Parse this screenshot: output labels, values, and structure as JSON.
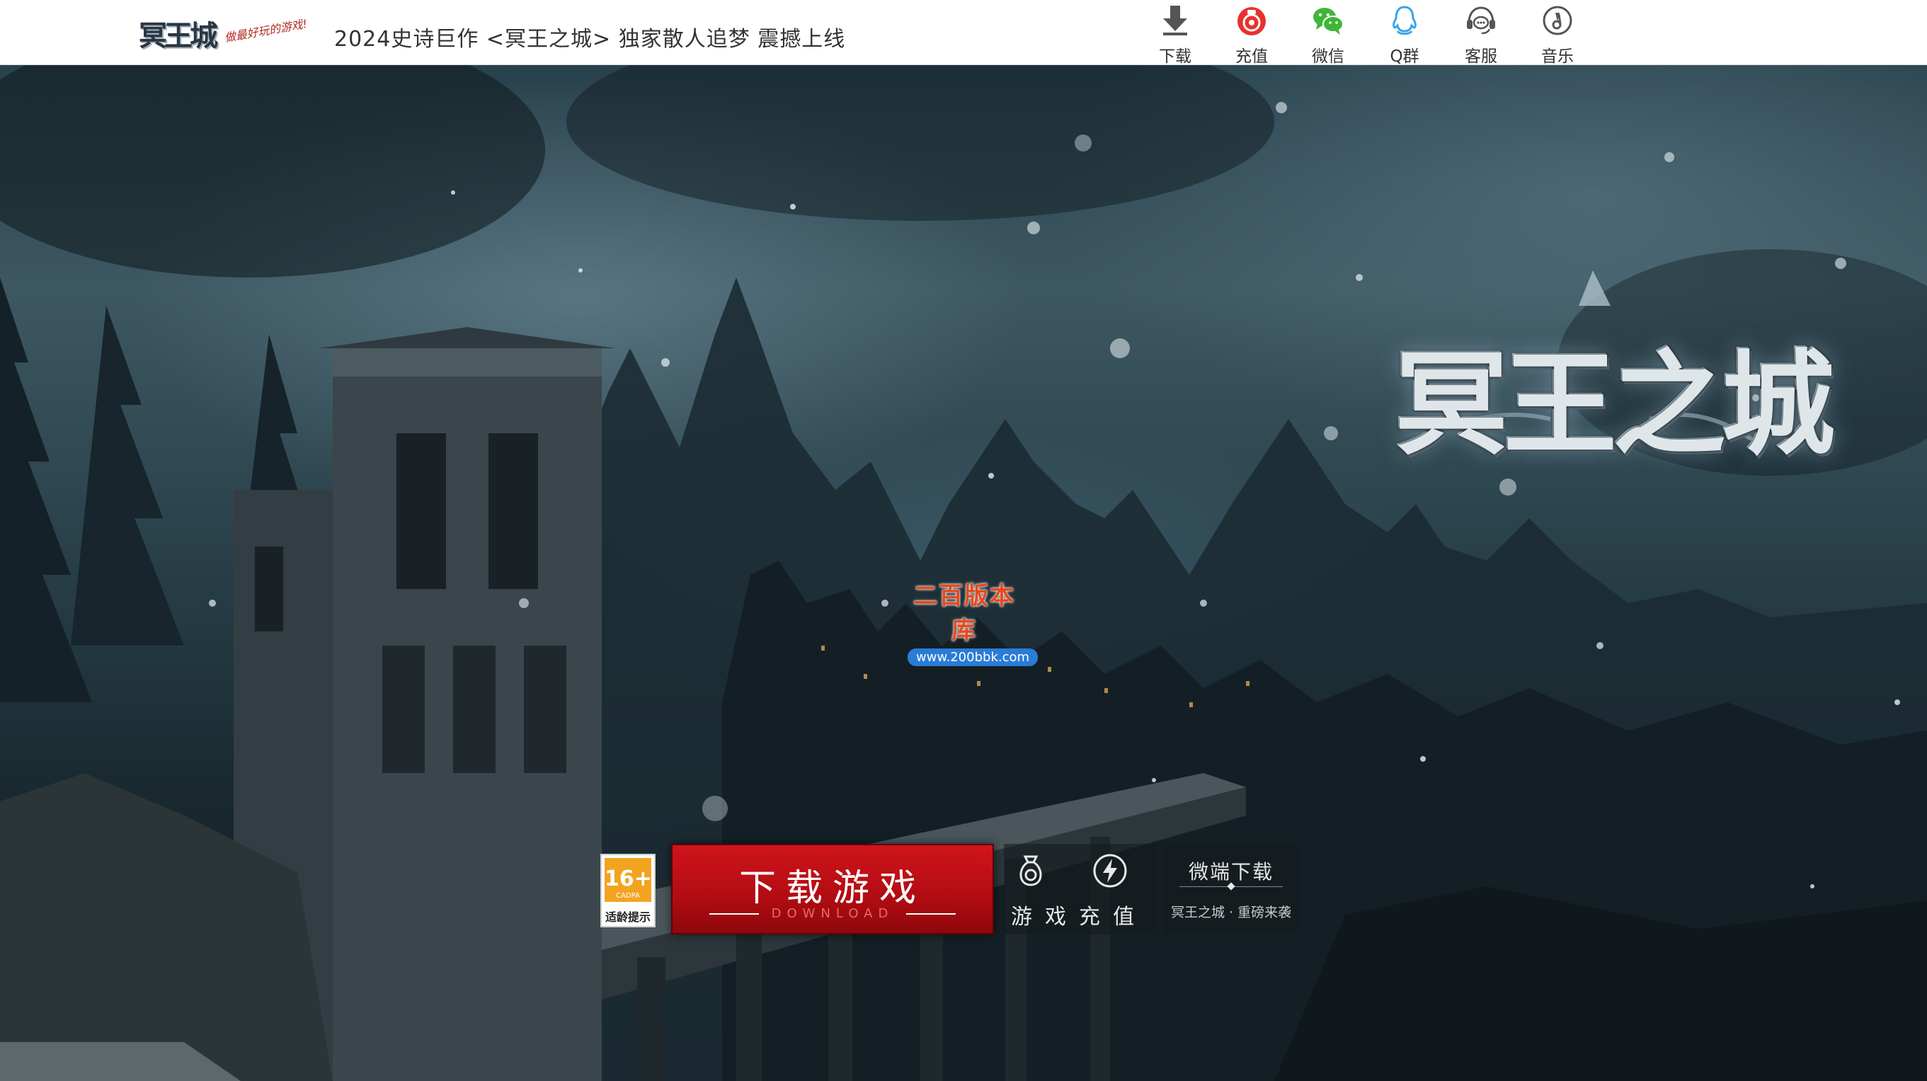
{
  "header": {
    "logo_text": "冥王城",
    "logo_slogan": "做最好玩的游戏!",
    "headline": "2024史诗巨作 <冥王之城> 独家散人追梦  震撼上线",
    "nav": [
      {
        "label": "下载",
        "icon": "download-arrow-icon"
      },
      {
        "label": "充值",
        "icon": "coin-bag-icon"
      },
      {
        "label": "微信",
        "icon": "wechat-icon"
      },
      {
        "label": "Q群",
        "icon": "qq-penguin-icon"
      },
      {
        "label": "客服",
        "icon": "headset-chat-icon"
      },
      {
        "label": "音乐",
        "icon": "music-note-icon"
      }
    ],
    "colors": {
      "recharge": "#e8312f",
      "wechat": "#3fb638",
      "qq": "#3aa3e8",
      "icon_gray": "#555555"
    }
  },
  "hero": {
    "game_logo_text": "冥王之城",
    "watermark": {
      "title": "二百版本库",
      "url": "www.200bbk.com"
    }
  },
  "actions": {
    "age_rating": {
      "number": "16+",
      "org": "CADPA",
      "tip": "适龄提示"
    },
    "download": {
      "label": "下载游戏",
      "sub": "DOWNLOAD"
    },
    "recharge": {
      "label": "游戏充值"
    },
    "micro_client": {
      "title": "微端下载",
      "subtitle": "冥王之城 · 重磅来袭"
    },
    "colors": {
      "download_bg": "#c5121a",
      "age_badge": "#f2a421"
    }
  }
}
